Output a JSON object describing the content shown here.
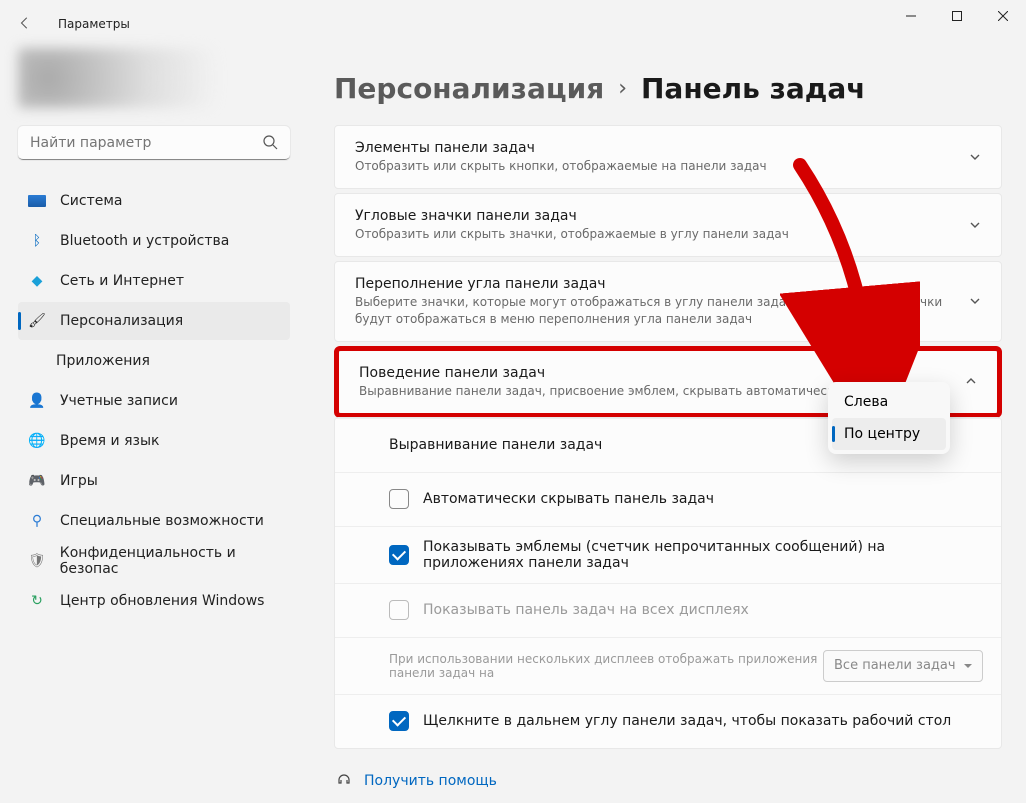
{
  "window": {
    "title": "Параметры"
  },
  "search": {
    "placeholder": "Найти параметр"
  },
  "sidebar": {
    "items": [
      {
        "label": "Система"
      },
      {
        "label": "Bluetooth и устройства"
      },
      {
        "label": "Сеть и Интернет"
      },
      {
        "label": "Персонализация"
      },
      {
        "label": "Приложения"
      },
      {
        "label": "Учетные записи"
      },
      {
        "label": "Время и язык"
      },
      {
        "label": "Игры"
      },
      {
        "label": "Специальные возможности"
      },
      {
        "label": "Конфиденциальность и безопас"
      },
      {
        "label": "Центр обновления Windows"
      }
    ]
  },
  "breadcrumb": {
    "parent": "Персонализация",
    "sep": "›",
    "current": "Панель задач"
  },
  "cards": {
    "c0": {
      "title": "Элементы панели задач",
      "sub": "Отобразить или скрыть кнопки, отображаемые на панели задач"
    },
    "c1": {
      "title": "Угловые значки панели задач",
      "sub": "Отобразить или скрыть значки, отображаемые в углу панели задач"
    },
    "c2": {
      "title": "Переполнение угла панели задач",
      "sub": "Выберите значки, которые могут отображаться в углу панели задач. Все остальные значки будут отображаться в меню переполнения угла панели задач"
    },
    "c3": {
      "title": "Поведение панели задач",
      "sub": "Выравнивание панели задач, присвоение эмблем, скрывать автоматически и несколь"
    }
  },
  "behavior": {
    "alignment_label": "Выравнивание панели задач",
    "auto_hide": "Автоматически скрывать панель задач",
    "show_badges": "Показывать эмблемы (счетчик непрочитанных сообщений) на приложениях панели задач",
    "all_displays": "Показывать панель задач на всех дисплеях",
    "multi_disp_label": "При использовании нескольких дисплеев отображать приложения панели задач на",
    "multi_disp_value": "Все панели задач",
    "far_corner": "Щелкните в дальнем углу панели задач, чтобы показать рабочий стол"
  },
  "dropdown": {
    "opt0": "Слева",
    "opt1": "По центру"
  },
  "help": {
    "label": "Получить помощь"
  }
}
